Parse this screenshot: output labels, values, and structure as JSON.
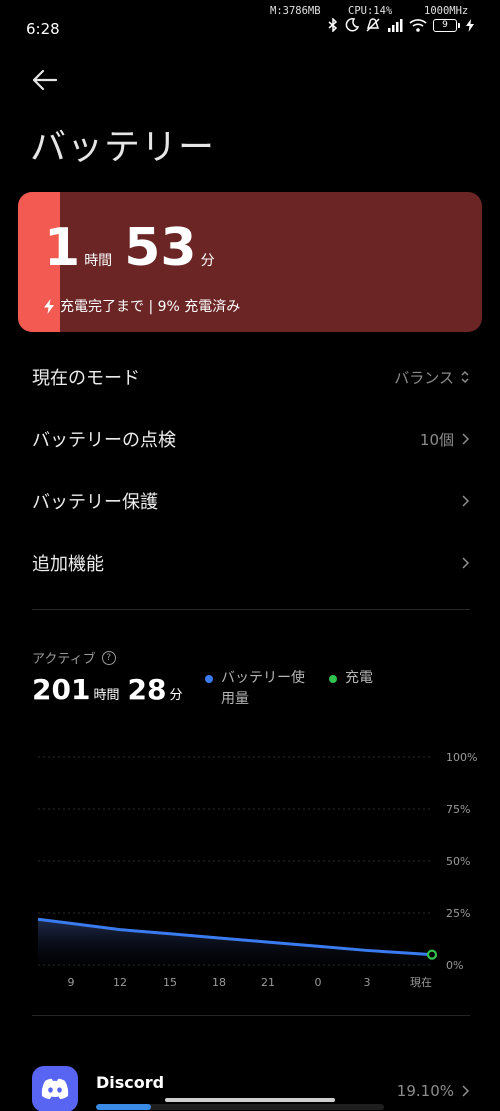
{
  "status": {
    "time": "6:28",
    "memory": "M:3786MB",
    "cpu": "CPU:14%",
    "freq": "1000MHz",
    "battery_level": "9",
    "icons": [
      "bluetooth-icon",
      "moon-icon",
      "mute-icon",
      "signal-icon",
      "wifi-icon",
      "battery-icon",
      "charging-bolt-icon"
    ]
  },
  "header": {
    "back_icon": "back-arrow-icon",
    "title": "バッテリー"
  },
  "battery_card": {
    "hours": "1",
    "hours_unit": "時間",
    "minutes": "53",
    "minutes_unit": "分",
    "subtitle": "充電完了まで | 9% 充電済み",
    "charge_level": 0.09,
    "fill_color": "#f25a52",
    "bg_color": "#6b2525"
  },
  "settings": [
    {
      "label": "現在のモード",
      "value": "バランス",
      "icon": "up-down-chevron-icon"
    },
    {
      "label": "バッテリーの点検",
      "value": "10個",
      "icon": "chevron-right-icon"
    },
    {
      "label": "バッテリー保護",
      "value": "",
      "icon": "chevron-right-icon"
    },
    {
      "label": "追加機能",
      "value": "",
      "icon": "chevron-right-icon"
    }
  ],
  "active": {
    "label": "アクティブ",
    "hours": "201",
    "hours_unit": "時間",
    "minutes": "28",
    "minutes_unit": "分"
  },
  "chart_data": {
    "type": "area",
    "x": [
      "9",
      "12",
      "15",
      "18",
      "21",
      "0",
      "3",
      "現在"
    ],
    "series": [
      {
        "name": "バッテリー使用量",
        "color": "#3a7bf0",
        "values": [
          20,
          17,
          15,
          13,
          11,
          9,
          7,
          5
        ]
      }
    ],
    "legend": [
      {
        "label": "バッテリー使\n用量",
        "color": "#3a7bf0"
      },
      {
        "label": "充電",
        "color": "#33c24d"
      }
    ],
    "start_value": 22,
    "current_point": 5,
    "yticks": [
      "100%",
      "75%",
      "50%",
      "25%",
      "0%"
    ],
    "ylim": [
      0,
      100
    ],
    "grid": true
  },
  "apps": [
    {
      "name": "Discord",
      "percent": "19.10%",
      "usage": 0.191,
      "icon": "discord-icon"
    }
  ]
}
